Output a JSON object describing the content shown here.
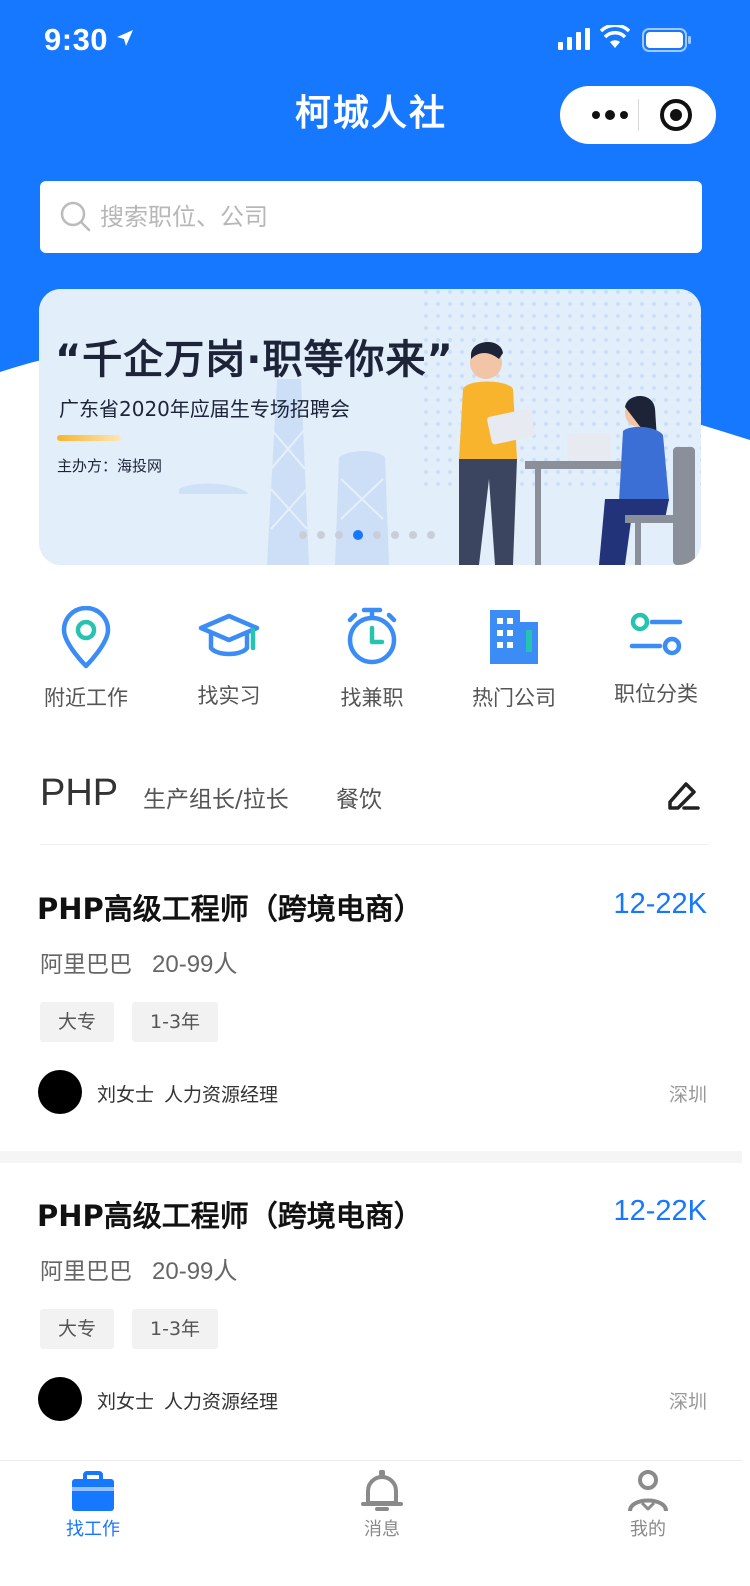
{
  "colors": {
    "primary": "#1677ff",
    "icon_blue": "#3b8cf5",
    "icon_teal": "#25c3b0",
    "text_dark": "#111111",
    "text_muted": "#999999",
    "tag_bg": "#f2f2f2"
  },
  "status_bar": {
    "time": "9:30",
    "icons": [
      "location-arrow-icon",
      "signal-icon",
      "wifi-icon",
      "battery-icon"
    ]
  },
  "header": {
    "title": "柯城人社",
    "capsule_icons": [
      "more-dots-icon",
      "close-target-icon"
    ]
  },
  "search": {
    "placeholder": "搜索职位、公司",
    "value": ""
  },
  "banner": {
    "headline": "“千企万岗·职等你来”",
    "subtitle": "广东省2020年应届生专场招聘会",
    "organizer": "主办方：海投网",
    "slide_count": 8,
    "active_slide": 4
  },
  "quick_nav": [
    {
      "label": "附近工作",
      "icon": "location-pin-icon"
    },
    {
      "label": "找实习",
      "icon": "graduation-cap-icon"
    },
    {
      "label": "找兼职",
      "icon": "alarm-clock-icon"
    },
    {
      "label": "热门公司",
      "icon": "office-building-icon"
    },
    {
      "label": "职位分类",
      "icon": "filter-sliders-icon"
    }
  ],
  "category_tabs": {
    "active": "PHP",
    "items": [
      "生产组长/拉长",
      "餐饮"
    ],
    "edit_icon": "edit-pen-icon"
  },
  "jobs": [
    {
      "title": "PHP高级工程师（跨境电商）",
      "salary": "12-22K",
      "company": "阿里巴巴",
      "company_size": "20-99人",
      "tags": [
        "大专",
        "1-3年"
      ],
      "recruiter_name": "刘女士",
      "recruiter_role": "人力资源经理",
      "city": "深圳"
    },
    {
      "title": "PHP高级工程师（跨境电商）",
      "salary": "12-22K",
      "company": "阿里巴巴",
      "company_size": "20-99人",
      "tags": [
        "大专",
        "1-3年"
      ],
      "recruiter_name": "刘女士",
      "recruiter_role": "人力资源经理",
      "city": "深圳"
    }
  ],
  "tabbar": [
    {
      "label": "找工作",
      "icon": "briefcase-icon",
      "active": true
    },
    {
      "label": "消息",
      "icon": "bell-icon",
      "active": false
    },
    {
      "label": "我的",
      "icon": "user-icon",
      "active": false
    }
  ]
}
